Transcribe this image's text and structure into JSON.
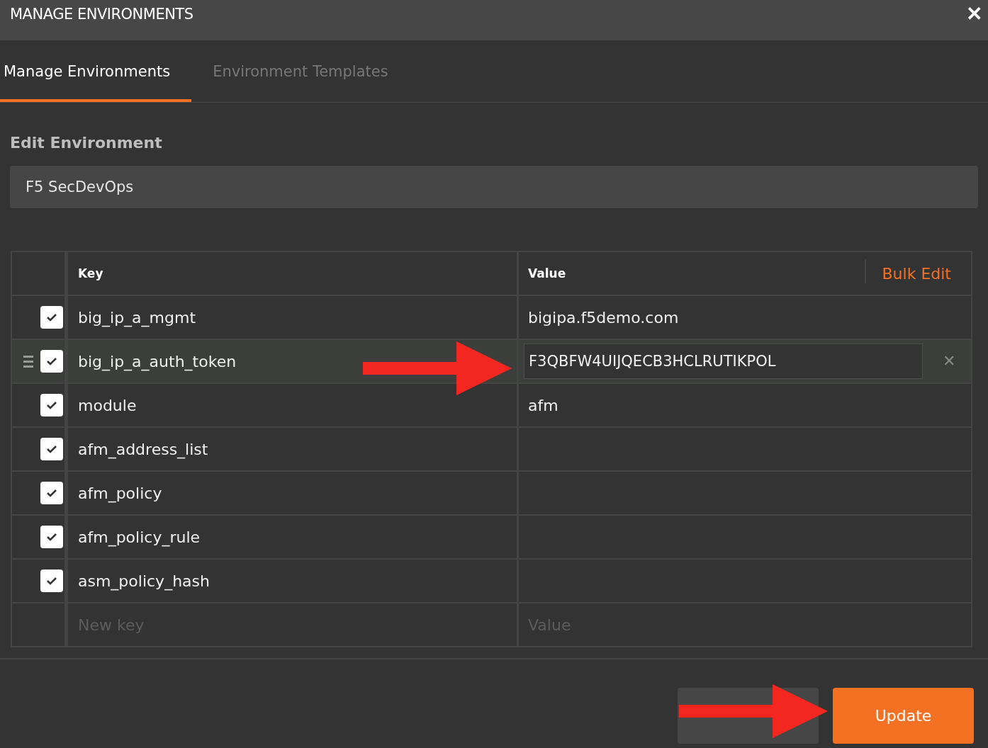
{
  "window": {
    "title": "MANAGE ENVIRONMENTS",
    "close": "✕"
  },
  "tabs": [
    {
      "label": "Manage Environments",
      "selected": true
    },
    {
      "label": "Environment Templates",
      "selected": false
    }
  ],
  "section_title": "Edit Environment",
  "environment_name": {
    "value": "F5 SecDevOps"
  },
  "table": {
    "columns": [
      "Key",
      "Value"
    ],
    "bulk_edit": "Bulk Edit",
    "rows": [
      {
        "key": "big_ip_a_mgmt",
        "value": "bigipa.f5demo.com",
        "checked": true,
        "hovered": false
      },
      {
        "key": "big_ip_a_auth_token",
        "value": "F3QBFW4UIJQECB3HCLRUTIKPOL",
        "checked": true,
        "hovered": true
      },
      {
        "key": "module",
        "value": "afm",
        "checked": true,
        "hovered": false
      },
      {
        "key": "afm_address_list",
        "checked": true,
        "hovered": false
      },
      {
        "key": "afm_policy",
        "checked": true,
        "hovered": false
      },
      {
        "key": "afm_policy_rule",
        "checked": true,
        "hovered": false
      },
      {
        "key": "asm_policy_hash",
        "checked": true,
        "hovered": false
      }
    ],
    "new_row": {
      "key_placeholder": "New key",
      "value_placeholder": "Value"
    },
    "delete": "✕"
  },
  "buttons": [
    {
      "kind": "secondary"
    },
    {
      "kind": "primary",
      "label": "Update"
    }
  ],
  "annotations": [
    {
      "kind": "arrow"
    },
    {
      "kind": "arrow"
    }
  ]
}
